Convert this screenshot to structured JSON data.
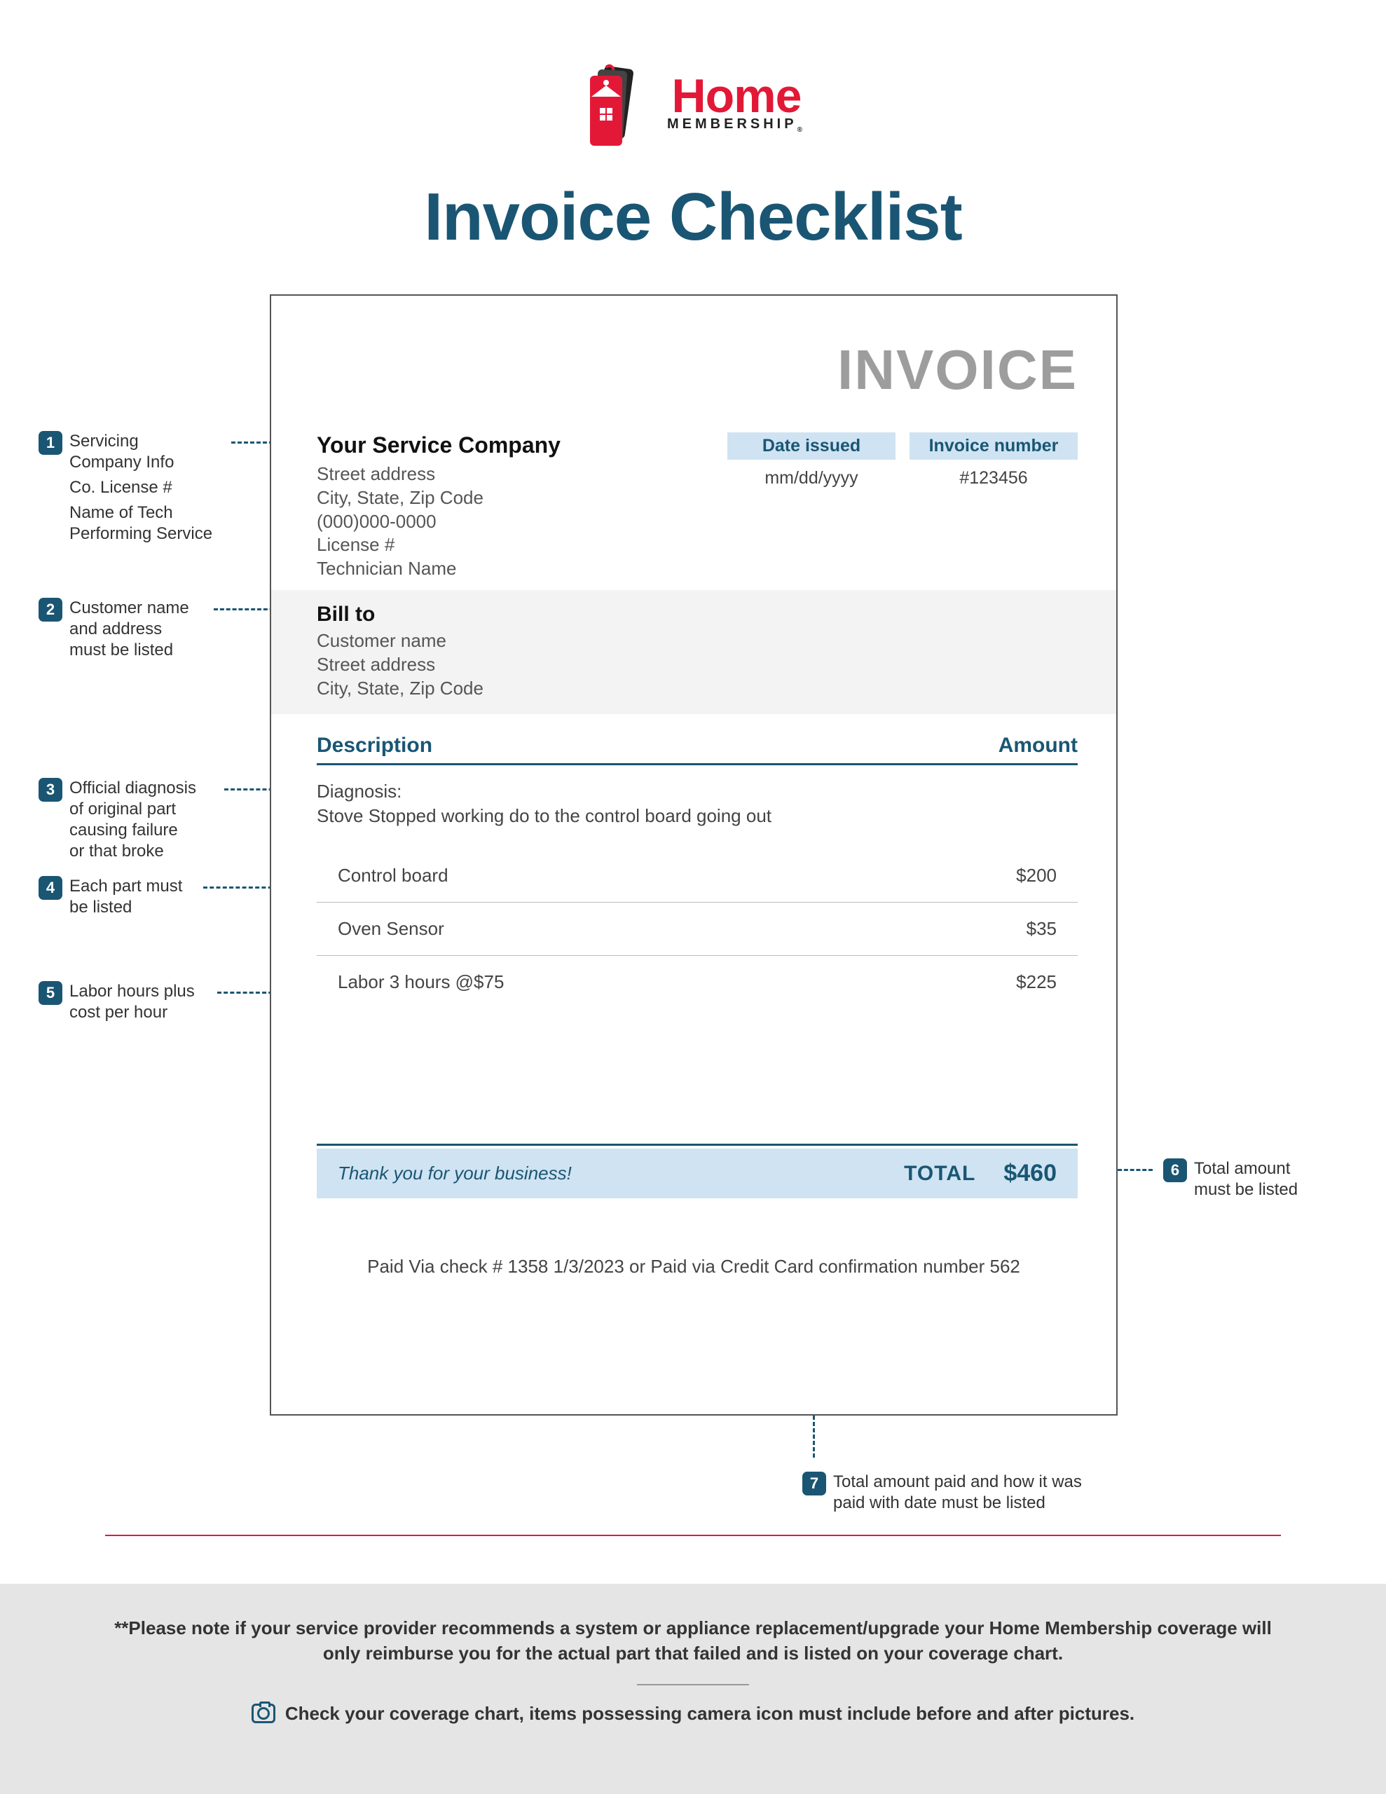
{
  "logo": {
    "top": "Home",
    "bot": "MEMBERSHIP",
    "reg": "®"
  },
  "page_title": "Invoice Checklist",
  "invoice_heading": "INVOICE",
  "service_company": {
    "name": "Your Service Company",
    "addr1": "Street address",
    "addr2": "City, State, Zip Code",
    "phone": "(000)000-0000",
    "license": "License #",
    "tech": "Technician Name"
  },
  "header_fields": {
    "date_label": "Date issued",
    "date_value": "mm/dd/yyyy",
    "invno_label": "Invoice number",
    "invno_value": "#123456"
  },
  "bill_to": {
    "heading": "Bill to",
    "name": "Customer name",
    "addr1": "Street address",
    "addr2": "City, State, Zip Code"
  },
  "columns": {
    "desc": "Description",
    "amount": "Amount"
  },
  "diagnosis": {
    "label": "Diagnosis:",
    "text": "Stove Stopped working do to the control board going out"
  },
  "line_items": [
    {
      "desc": "Control board",
      "amount": "$200"
    },
    {
      "desc": "Oven Sensor",
      "amount": "$35"
    },
    {
      "desc": "Labor 3 hours @$75",
      "amount": "$225"
    }
  ],
  "thanks": "Thank you for your business!",
  "total_label": "TOTAL",
  "total_amount": "$460",
  "paid_note": "Paid Via check # 1358 1/3/2023 or Paid via Credit Card confirmation number 562",
  "annotations": {
    "a1_l1": "Servicing",
    "a1_l2": "Company Info",
    "a1_l3": "Co. License #",
    "a1_l4": "Name of Tech",
    "a1_l5": "Performing Service",
    "a2_l1": "Customer name",
    "a2_l2": "and address",
    "a2_l3": "must be listed",
    "a3_l1": "Official diagnosis",
    "a3_l2": "of original part",
    "a3_l3": "causing failure",
    "a3_l4": "or that broke",
    "a4_l1": "Each part must",
    "a4_l2": "be listed",
    "a5_l1": "Labor hours plus",
    "a5_l2": "cost per hour",
    "a6_l1": "Total amount",
    "a6_l2": "must be listed",
    "a7_l1": "Total amount paid and how it was",
    "a7_l2": "paid with date must be listed"
  },
  "footer": {
    "note1": "**Please note if your service provider recommends a system or appliance replacement/upgrade your Home Membership coverage will only reimburse you for the actual part that failed and is listed on your coverage chart.",
    "note2": "Check your coverage chart, items possessing camera icon must include before and after pictures."
  }
}
